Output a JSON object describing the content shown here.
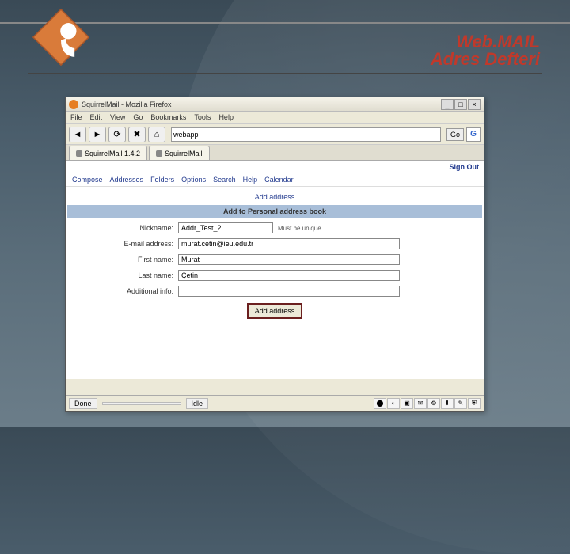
{
  "header": {
    "title_line1": "Web.MAIL",
    "title_line2": "Adres Defteri"
  },
  "browser": {
    "window_title": "SquirrelMail - Mozilla Firefox",
    "menu": {
      "file": "File",
      "edit": "Edit",
      "view": "View",
      "go": "Go",
      "bookmarks": "Bookmarks",
      "tools": "Tools",
      "help": "Help"
    },
    "toolbar": {
      "back": "◄",
      "forward": "►",
      "reload": "⟳",
      "stop": "✖",
      "home": "⌂",
      "url_value": "webapp",
      "go": "Go",
      "search_icon": "G"
    },
    "tabs": [
      {
        "label": "SquirrelMail 1.4.2"
      },
      {
        "label": "SquirrelMail"
      }
    ],
    "status": {
      "done": "Done",
      "idle": "Idle"
    }
  },
  "squirrelmail": {
    "signout": "Sign Out",
    "nav": {
      "compose": "Compose",
      "addresses": "Addresses",
      "folders": "Folders",
      "options": "Options",
      "search": "Search",
      "help": "Help",
      "calendar": "Calendar"
    },
    "add_address_link": "Add address",
    "section_title": "Add to Personal address book",
    "labels": {
      "nickname": "Nickname:",
      "email": "E-mail address:",
      "first": "First name:",
      "last": "Last name:",
      "info": "Additional info:"
    },
    "values": {
      "nickname": "Addr_Test_2",
      "email": "murat.cetin@ieu.edu.tr",
      "first": "Murat",
      "last": "Çetin",
      "info": ""
    },
    "hint": "Must be unique",
    "submit": "Add address"
  }
}
